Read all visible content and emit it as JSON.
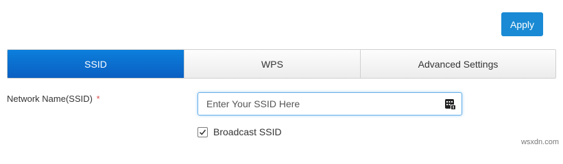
{
  "toolbar": {
    "apply_label": "Apply"
  },
  "tabs": [
    {
      "label": "SSID",
      "active": true
    },
    {
      "label": "WPS",
      "active": false
    },
    {
      "label": "Advanced Settings",
      "active": false
    }
  ],
  "form": {
    "network_name": {
      "label": "Network Name(SSID)",
      "required_mark": "*",
      "value": "",
      "placeholder": "Enter Your SSID Here"
    },
    "broadcast": {
      "label": "Broadcast SSID",
      "checked": true
    }
  },
  "watermark": "wsxdn.com",
  "colors": {
    "accent": "#1a8ad4",
    "active_tab": "#0a6fd0",
    "required": "#d9534f",
    "input_focus": "#66afe9"
  },
  "icons": {
    "input_icon": "password-manager-icon",
    "checkbox": "checkmark-icon"
  }
}
